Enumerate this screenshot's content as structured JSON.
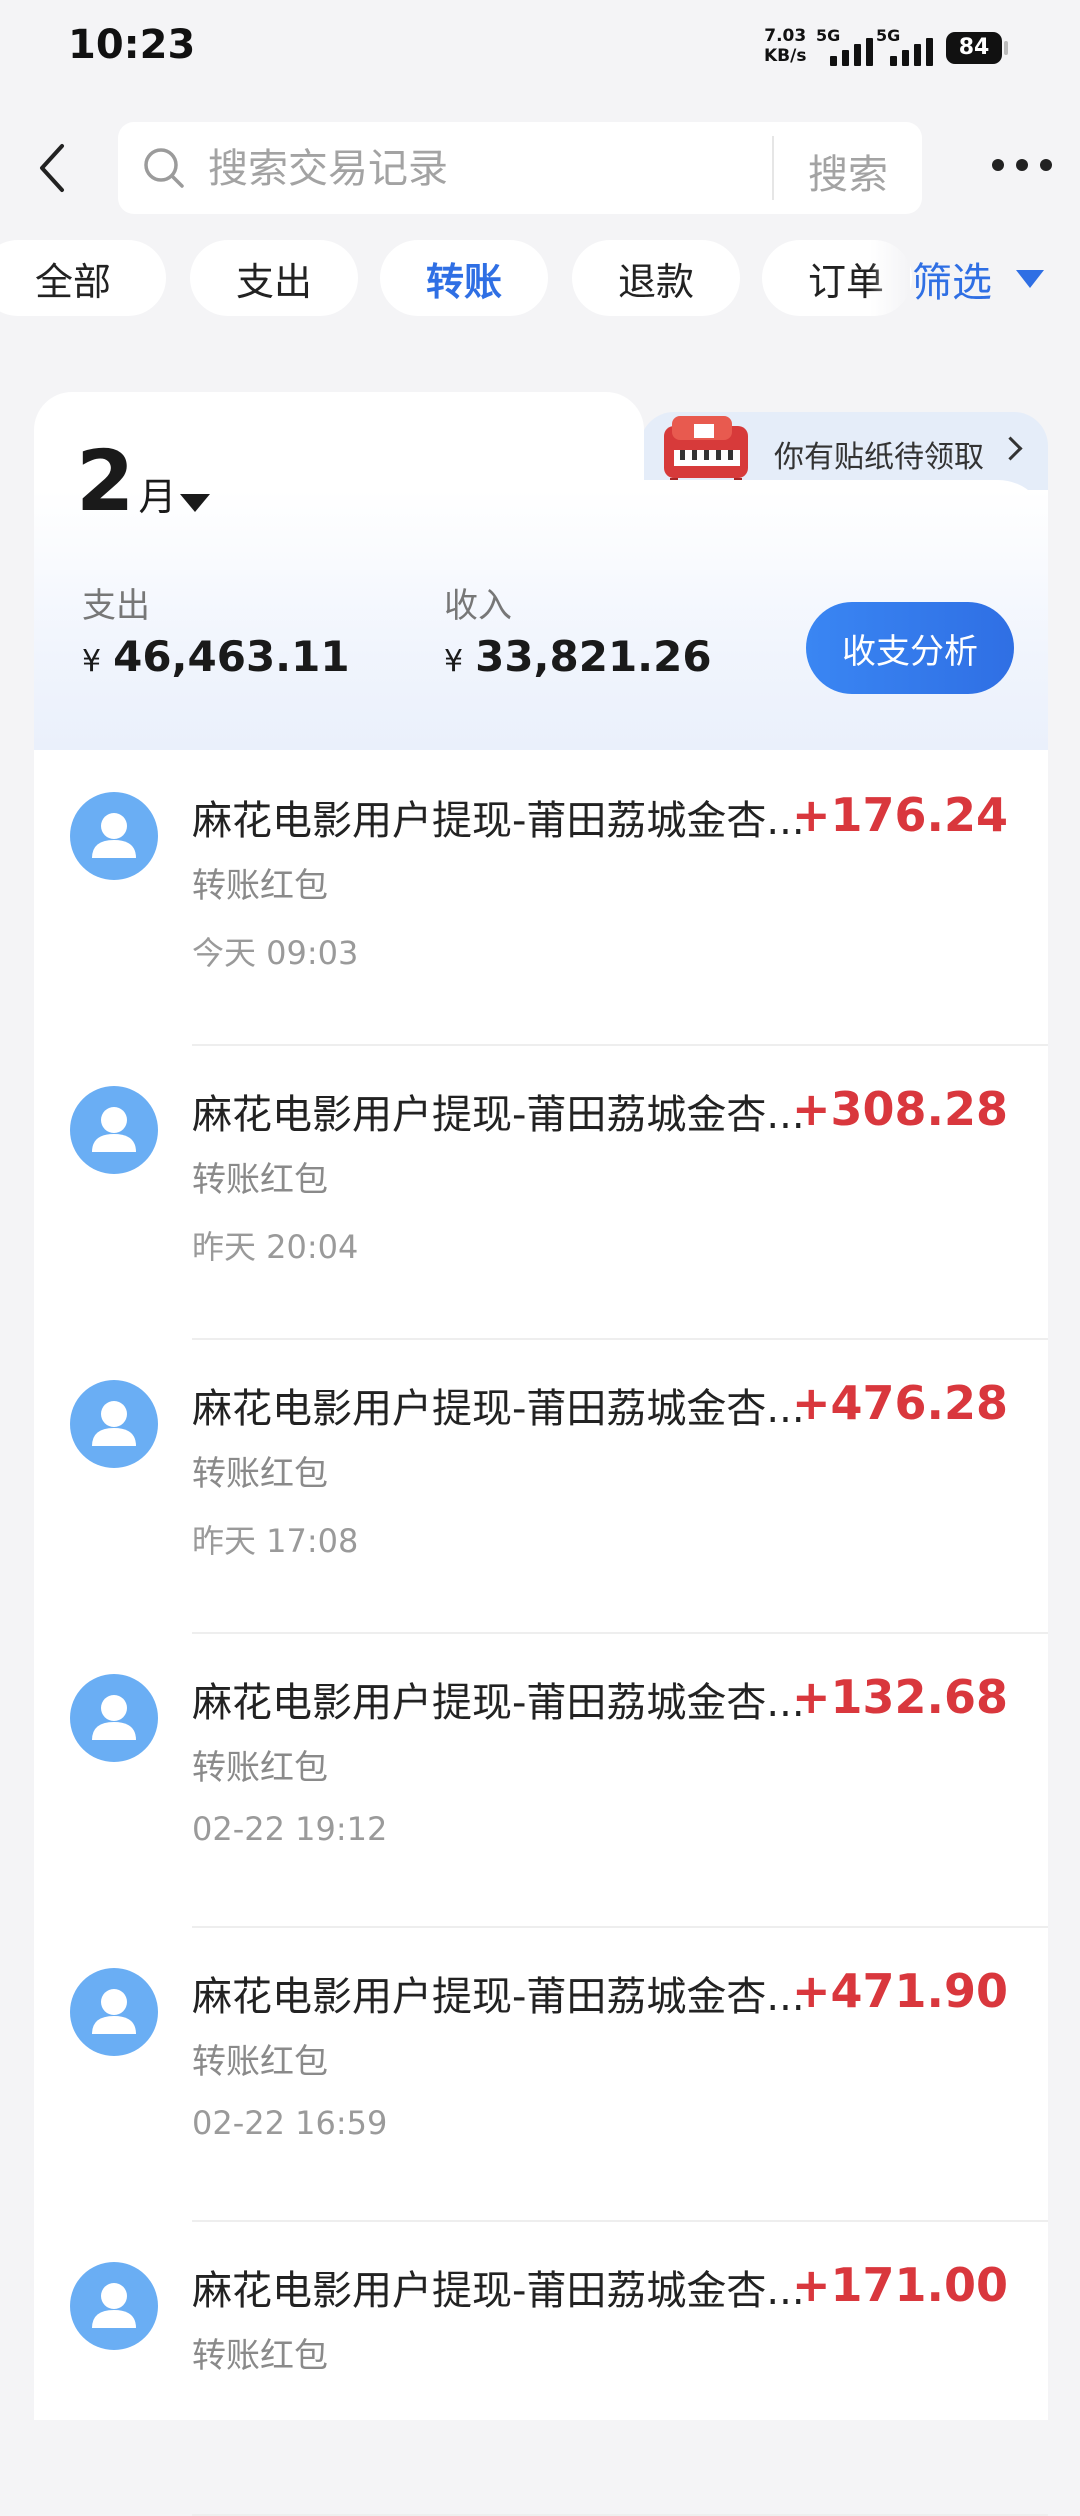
{
  "status_bar": {
    "time": "10:23",
    "net_speed": "7.03",
    "net_unit": "KB/s",
    "signal1_label": "5G",
    "signal2_label": "5G",
    "battery": "84"
  },
  "search": {
    "placeholder": "搜索交易记录",
    "button_label": "搜索",
    "back_icon": "chevron-left-icon",
    "search_icon": "search-icon",
    "more_icon": "more-horizontal-icon"
  },
  "filters": {
    "chips": [
      "全部",
      "支出",
      "转账",
      "退款",
      "订单"
    ],
    "active": "转账",
    "filter_label": "筛选",
    "accent": "#2f6fe4"
  },
  "sticker_promo": {
    "text": "你有贴纸待领取",
    "icon": "piano-sticker-icon"
  },
  "summary": {
    "month": "2",
    "month_unit": "月",
    "expense_label": "支出",
    "expense_amount": "46,463.11",
    "income_label": "收入",
    "income_amount": "33,821.26",
    "currency": "¥",
    "analysis_button": "收支分析"
  },
  "transactions": [
    {
      "title": "麻花电影用户提现-莆田荔城金杏...",
      "category": "转账红包",
      "time": "今天 09:03",
      "amount": "+176.24"
    },
    {
      "title": "麻花电影用户提现-莆田荔城金杏...",
      "category": "转账红包",
      "time": "昨天 20:04",
      "amount": "+308.28"
    },
    {
      "title": "麻花电影用户提现-莆田荔城金杏...",
      "category": "转账红包",
      "time": "昨天 17:08",
      "amount": "+476.28"
    },
    {
      "title": "麻花电影用户提现-莆田荔城金杏...",
      "category": "转账红包",
      "time": "02-22 19:12",
      "amount": "+132.68"
    },
    {
      "title": "麻花电影用户提现-莆田荔城金杏...",
      "category": "转账红包",
      "time": "02-22 16:59",
      "amount": "+471.90"
    },
    {
      "title": "麻花电影用户提现-莆田荔城金杏...",
      "category": "转账红包",
      "time": "",
      "amount": "+171.00"
    }
  ],
  "colors": {
    "income_red": "#d9373d",
    "avatar_blue": "#6aaef4"
  }
}
